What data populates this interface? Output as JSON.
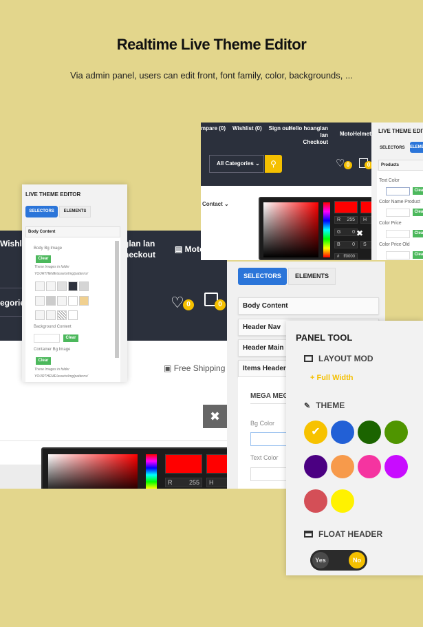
{
  "title": "Realtime Live Theme Editor",
  "subtitle": "Via admin panel, users can edit front, font family, color, backgrounds, ...",
  "colors": {
    "background": "#e3d68c",
    "accent": "#f5c000",
    "primary": "#2b75d9",
    "green": "#4cb85c",
    "header": "#2b303c"
  },
  "left_shot": {
    "wishlist": "Wishlis",
    "user": "glan lan",
    "checkout": "heckout",
    "store": "Moto",
    "categories": "egorie",
    "wishlist_count": "0",
    "cart_count": "0",
    "shipping": "Free Shipping",
    "close_icon": "close-icon",
    "picker": {
      "r_label": "R",
      "r_value": "255",
      "h_label": "H"
    }
  },
  "top_shot": {
    "nav": [
      "mpare (0)",
      "Wishlist (0)",
      "Sign out"
    ],
    "user": "Hello hoanglan lan",
    "checkout": "Checkout",
    "store": "MotoHelmet",
    "categories": "All Categories",
    "wishlist_count": "0",
    "cart_count": "0",
    "contact": "Contact",
    "picker": {
      "r_label": "R",
      "r_value": "255",
      "g_label": "G",
      "g_value": "0",
      "b_label": "B",
      "b_value": "0",
      "hash_label": "#",
      "hex": "ff0000",
      "h_label": "H",
      "s_label": "S"
    },
    "editor": {
      "title": "LIVE THEME EDITOR",
      "tab_selectors": "SELECTORS",
      "tab_elements": "ELEMENTS",
      "section": "Products",
      "fields": [
        "Text Color",
        "Color Name Product",
        "Color Price",
        "Color Price Old"
      ],
      "clear": "Clear"
    }
  },
  "left_editor": {
    "title": "LIVE THEME EDITOR",
    "tab_selectors": "SELECTORS",
    "tab_elements": "ELEMENTS",
    "section": "Body Content",
    "body_bg": "Body Bg Image",
    "clear": "Clear",
    "note1": "These Images in folder",
    "note2": "YOURTHEME/assets/img/patterns/",
    "bg_content": "Background Content",
    "container_bg": "Container Bg Image"
  },
  "mid_panel": {
    "tab_selectors": "SELECTORS",
    "tab_elements": "ELEMENTS",
    "sections": [
      "Body Content",
      "Header Nav",
      "Header Main",
      "Items Header"
    ],
    "mega": "MEGA MEGA",
    "bg_color": "Bg Color",
    "text_color": "Text Color"
  },
  "panel_tool": {
    "title": "PANEL TOOL",
    "layout": "LAYOUT MOD",
    "full_width": "+ Full Width",
    "theme": "THEME",
    "theme_colors": [
      "#f7c200",
      "#2260d6",
      "#1b6400",
      "#4f9500",
      "#4b0082",
      "#f79a4b",
      "#f534a0",
      "#c80cff",
      "#d44f57",
      "#fff200"
    ],
    "selected_color": "#f7c200",
    "float_header": "FLOAT HEADER",
    "toggle_yes": "Yes",
    "toggle_no": "No",
    "float_header_value": "No"
  }
}
